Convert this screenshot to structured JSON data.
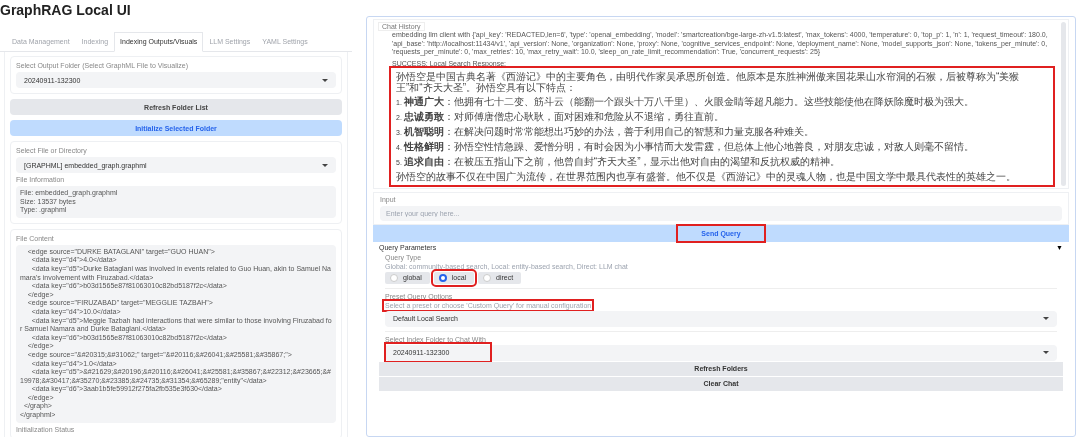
{
  "app_title": "GraphRAG Local UI",
  "tabs": [
    {
      "label": "Data Management",
      "selected": false
    },
    {
      "label": "Indexing",
      "selected": false
    },
    {
      "label": "Indexing Outputs/Visuals",
      "selected": true
    },
    {
      "label": "LLM Settings",
      "selected": false
    },
    {
      "label": "YAML Settings",
      "selected": false
    }
  ],
  "output_folder": {
    "label": "Select Output Folder (Select GraphML File to Visualize)",
    "value": "20240911-132300"
  },
  "left_buttons": [
    {
      "label": "Refresh Folder List",
      "kind": "secondary"
    },
    {
      "label": "Initialize Selected Folder",
      "kind": "primary"
    }
  ],
  "file_select": {
    "label": "Select File or Directory",
    "value": "[GRAPHML] embedded_graph.graphml"
  },
  "file_information": {
    "label": "File Information",
    "lines": [
      "File: embedded_graph.graphml",
      "Size: 13537 bytes",
      "Type: .graphml"
    ]
  },
  "file_content": {
    "label": "File Content",
    "lines": [
      "    <edge source=\"DURKE BATAGLANI\" target=\"GUO HUAN\">",
      "      <data key=\"d4\">4.0</data>",
      "      <data key=\"d5\">Durke Bataglani was involved in events related to Guo Huan, akin to Samuel Namara's involvement with Firuzabad.</data>",
      "      <data key=\"d6\">b03d1565e87f81063010c82bd5187f2c</data>",
      "    </edge>",
      "    <edge source=\"FIRUZABAD\" target=\"MEGGLIE TAZBAH\">",
      "      <data key=\"d4\">10.0</data>",
      "      <data key=\"d5\">Meggie Tazbah had interactions that were similar to those involving Firuzabad for Samuel Namara and Durke Bataglani.</data>",
      "      <data key=\"d6\">b03d1565e87f81063010c82bd5187f2c</data>",
      "    </edge>",
      "    <edge source=\"&#20315;&#31062;\" target=\"&#20116;&#26041;&#25581;&#35867;\">",
      "      <data key=\"d4\">1.0</data>",
      "      <data key=\"d5\">&#21629;&#20196;&#20116;&#26041;&#25581;&#35867;&#22312;&#23665;&#19978;&#30417;&#35270;&#23385;&#24735;&#31354;&#65289;\"entity\"</data>",
      "      <data key=\"d6\">3aab1b5fe59912f275fa2fb535e3f630</data>",
      "    </edge>",
      "  </graph>",
      "</graphml>"
    ]
  },
  "initialization_status": {
    "label": "Initialization Status"
  },
  "chat_history": {
    "label": "Chat History",
    "log_text": "embedding llm client with {'api_key': 'REDACTED,len=6', 'type': 'openai_embedding', 'model': 'smartcreation/bge-large-zh-v1.5:latest', 'max_tokens': 4000, 'temperature': 0, 'top_p': 1, 'n': 1, 'request_timeout': 180.0, 'api_base': 'http://localhost:11434/v1', 'api_version': None, 'organization': None, 'proxy': None, 'cognitive_services_endpoint': None, 'deployment_name': None, 'model_supports_json': None, 'tokens_per_minute': 0, 'requests_per_minute': 0, 'max_retries': 10, 'max_retry_wait': 10.0, 'sleep_on_rate_limit_recommendation': True, 'concurrent_requests': 25}",
    "status_line": "SUCCESS: Local Search Response:",
    "response": {
      "highlighted": true,
      "intro": "孙悟空是中国古典名著《西游记》中的主要角色，由明代作家吴承恩所创造。他原本是东胜神洲傲来国花果山水帘洞的石猴，后被尊称为“美猴王”和“齐天大圣”。孙悟空具有以下特点：",
      "points": [
        {
          "number": "1.",
          "title": "神通广大",
          "text": "：他拥有七十二变、筋斗云（能翻一个跟头十万八千里）、火眼金睛等超凡能力。这些技能使他在降妖除魔时极为强大。"
        },
        {
          "number": "2.",
          "title": "忠诚勇敢",
          "text": "：对师傅唐僧忠心耿耿，面对困难和危险从不退缩，勇往直前。"
        },
        {
          "number": "3.",
          "title": "机智聪明",
          "text": "：在解决问题时常常能想出巧妙的办法，善于利用自己的智慧和力量克服各种难关。"
        },
        {
          "number": "4.",
          "title": "性格鲜明",
          "text": "：孙悟空性情急躁、爱憎分明，有时会因为小事情而大发雷霆，但总体上他心地善良，对朋友忠诚，对敌人则毫不留情。"
        },
        {
          "number": "5.",
          "title": "追求自由",
          "text": "：在被压五指山下之前，他曾自封“齐天大圣”，显示出他对自由的渴望和反抗权威的精神。"
        }
      ],
      "outro": "孙悟空的故事不仅在中国广为流传，在世界范围内也享有盛誉。他不仅是《西游记》中的灵魂人物，也是中国文学中最具代表性的英雄之一。"
    }
  },
  "input": {
    "label": "Input",
    "placeholder": "Enter your query here..."
  },
  "send_button": {
    "label": "Send Query",
    "highlighted": true
  },
  "query_parameters": {
    "title": "Query Parameters",
    "toggle": "▼",
    "expanded": true,
    "query_type": {
      "label": "Query Type",
      "hint": "Global: community-based search, Local: entity-based search, Direct: LLM chat",
      "options": [
        {
          "label": "global",
          "selected": false,
          "highlighted": false
        },
        {
          "label": "local",
          "selected": true,
          "highlighted": true
        },
        {
          "label": "direct",
          "selected": false,
          "highlighted": false
        }
      ]
    },
    "preset": {
      "label": "Preset Query Options",
      "hint": "Select a preset or choose 'Custom Query' for manual configuration",
      "hint_highlighted": true,
      "value": "Default Local Search"
    },
    "index_folder": {
      "label": "Select Index Folder to Chat With",
      "value": "20240911-132300",
      "highlighted": true
    }
  },
  "right_buttons": [
    {
      "label": "Refresh Folders"
    },
    {
      "label": "Clear Chat"
    }
  ]
}
